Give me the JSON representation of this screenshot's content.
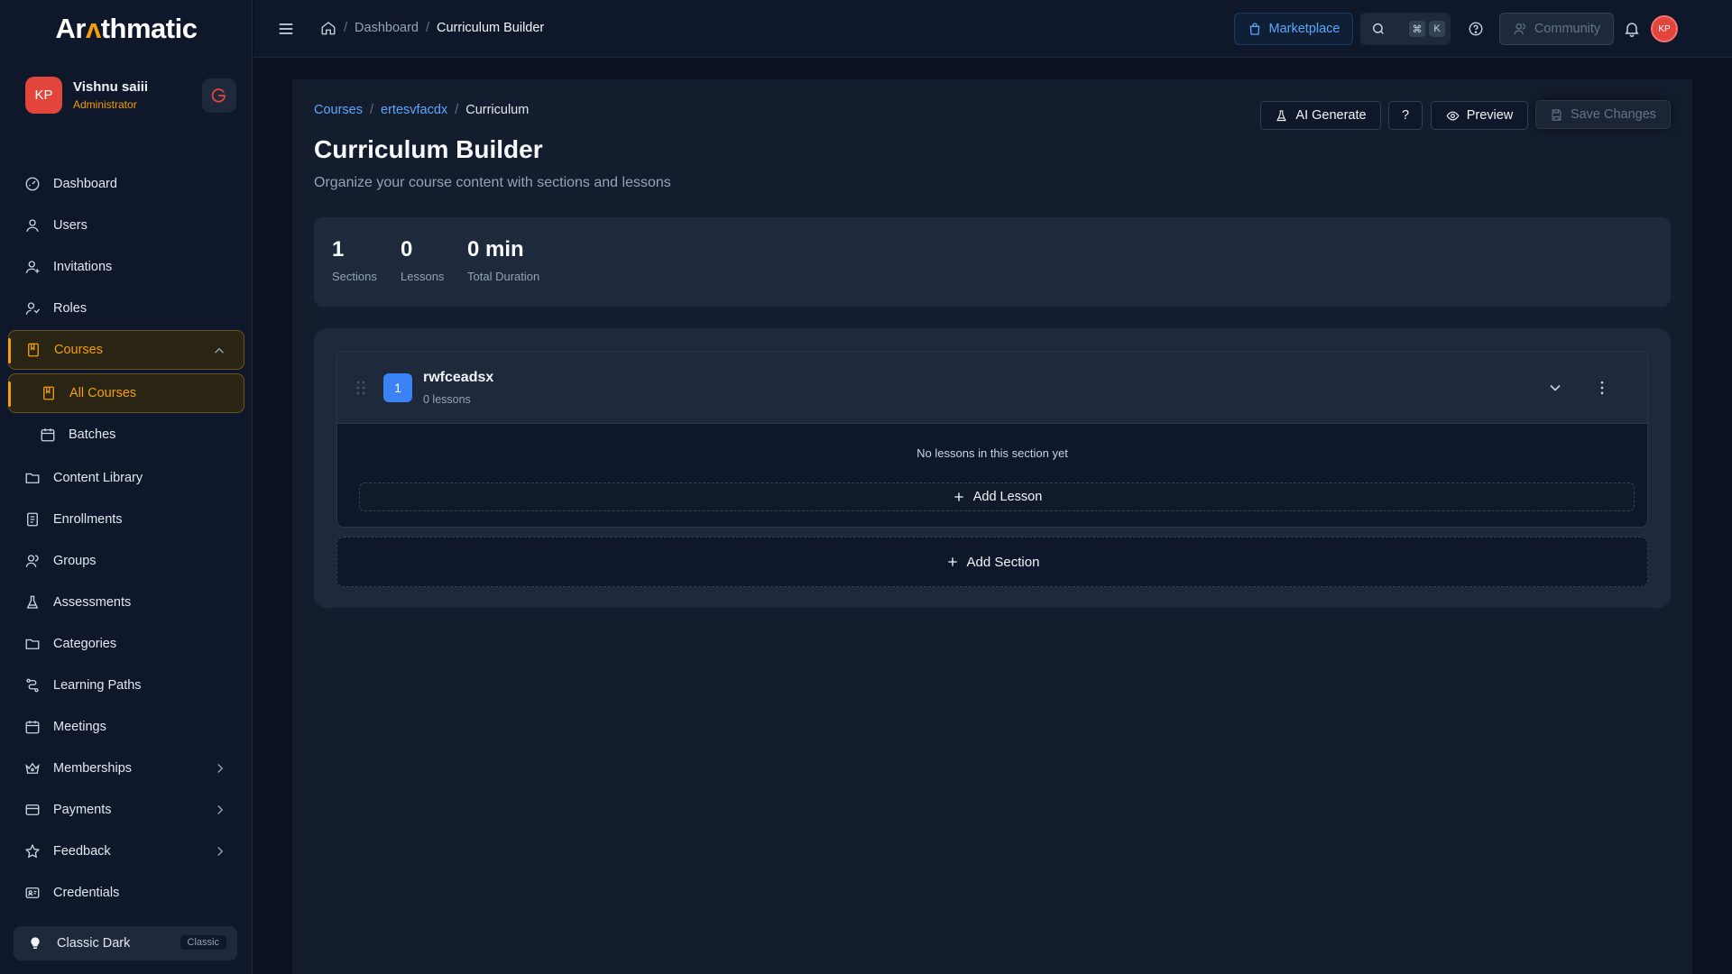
{
  "brand": {
    "name_pre": "Ar",
    "name_accent": "ʌ",
    "name_post": "thmatic"
  },
  "user": {
    "initials": "KP",
    "name": "Vishnu saiii",
    "role": "Administrator"
  },
  "sidebar": {
    "items": [
      {
        "label": "Dashboard",
        "icon": "dashboard-icon"
      },
      {
        "label": "Users",
        "icon": "user-icon"
      },
      {
        "label": "Invitations",
        "icon": "user-plus-icon"
      },
      {
        "label": "Roles",
        "icon": "roles-icon"
      },
      {
        "label": "Courses",
        "icon": "book-icon",
        "expanded": true
      },
      {
        "label": "All Courses",
        "icon": "book-icon",
        "active": true
      },
      {
        "label": "Batches",
        "icon": "calendar-icon"
      },
      {
        "label": "Content Library",
        "icon": "folder-icon"
      },
      {
        "label": "Enrollments",
        "icon": "enrollment-icon"
      },
      {
        "label": "Groups",
        "icon": "groups-icon"
      },
      {
        "label": "Assessments",
        "icon": "flask-icon"
      },
      {
        "label": "Categories",
        "icon": "folder-icon"
      },
      {
        "label": "Learning Paths",
        "icon": "path-icon"
      },
      {
        "label": "Meetings",
        "icon": "calendar-icon"
      },
      {
        "label": "Memberships",
        "icon": "crown-icon"
      },
      {
        "label": "Payments",
        "icon": "card-icon"
      },
      {
        "label": "Feedback",
        "icon": "star-icon"
      },
      {
        "label": "Credentials",
        "icon": "credential-icon"
      }
    ],
    "theme": {
      "label": "Classic Dark",
      "badge": "Classic"
    }
  },
  "topbar": {
    "breadcrumb": [
      "Dashboard",
      "Curriculum Builder"
    ],
    "marketplace_label": "Marketplace",
    "shortcut_keys": [
      "⌘",
      "K"
    ],
    "community_label": "Community",
    "avatar_initials": "KP"
  },
  "page": {
    "breadcrumb": [
      "Courses",
      "ertesvfacdx",
      "Curriculum"
    ],
    "title": "Curriculum Builder",
    "subtitle": "Organize your course content with sections and lessons",
    "actions": {
      "ai_generate": "AI Generate",
      "help": "?",
      "preview": "Preview",
      "save": "Save Changes"
    },
    "stats": [
      {
        "value": "1",
        "label": "Sections"
      },
      {
        "value": "0",
        "label": "Lessons"
      },
      {
        "value": "0 min",
        "label": "Total Duration"
      }
    ],
    "section": {
      "number": "1",
      "title": "rwfceadsx",
      "lesson_count": "0 lessons",
      "empty_message": "No lessons in this section yet",
      "add_lesson_label": "Add Lesson"
    },
    "add_section_label": "Add Section"
  },
  "colors": {
    "accent": "#f59e0b",
    "link": "#60a5fa",
    "avatar": "#e2453b",
    "section_badge": "#3b82f6"
  }
}
